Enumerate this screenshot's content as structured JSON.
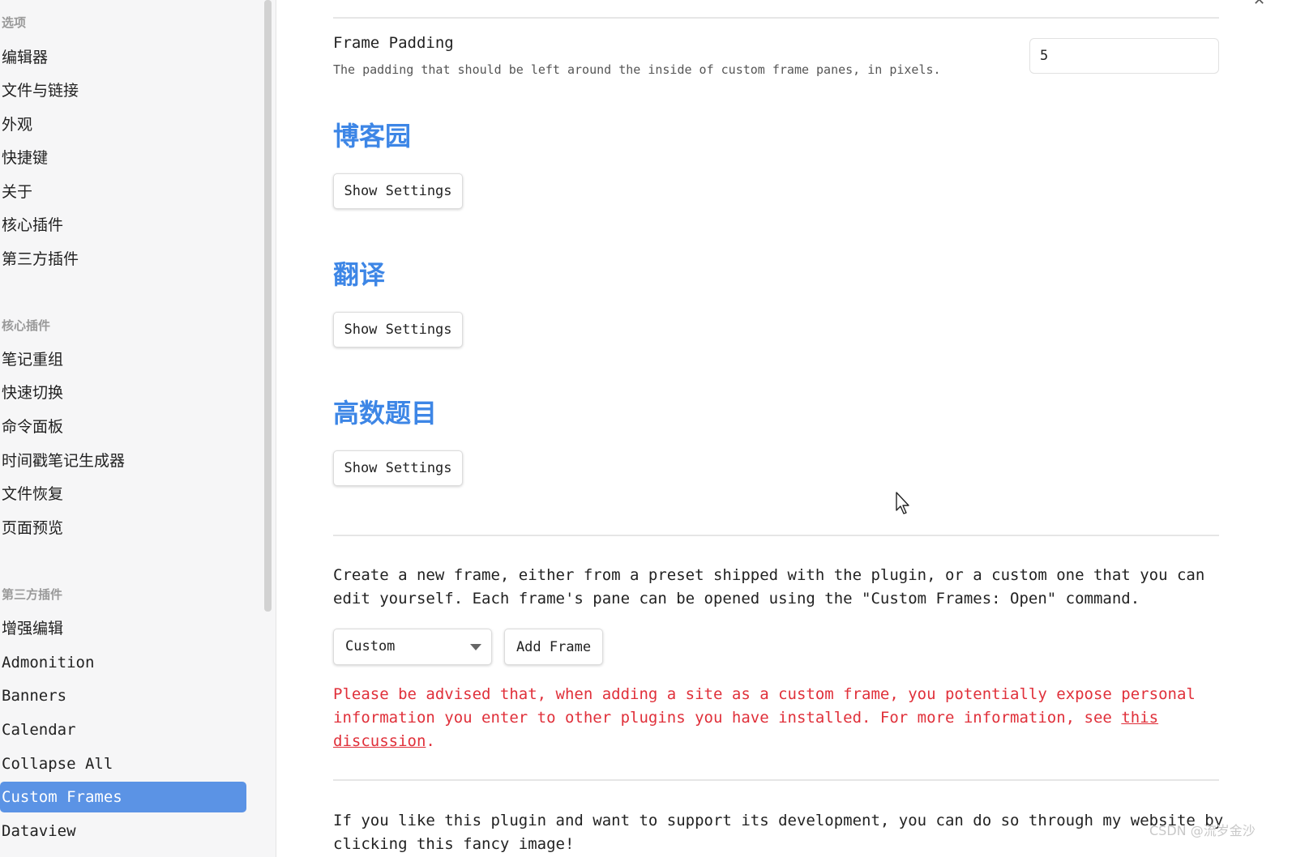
{
  "sidebar": {
    "options_heading": "选项",
    "options_items": [
      "编辑器",
      "文件与链接",
      "外观",
      "快捷键",
      "关于",
      "核心插件",
      "第三方插件"
    ],
    "core_heading": "核心插件",
    "core_items": [
      "笔记重组",
      "快速切换",
      "命令面板",
      "时间戳笔记生成器",
      "文件恢复",
      "页面预览"
    ],
    "community_heading": "第三方插件",
    "community_items": [
      "增强编辑",
      "Admonition",
      "Banners",
      "Calendar",
      "Collapse All",
      "Custom Frames",
      "Dataview"
    ],
    "active_item": "Custom Frames"
  },
  "frame_padding": {
    "name": "Frame Padding",
    "description": "The padding that should be left around the inside of custom frame panes, in pixels.",
    "value": "5"
  },
  "frames": [
    {
      "title": "博客园",
      "button_label": "Show Settings"
    },
    {
      "title": "翻译",
      "button_label": "Show Settings"
    },
    {
      "title": "高数题目",
      "button_label": "Show Settings"
    }
  ],
  "create": {
    "description": "Create a new frame, either from a preset shipped with the plugin, or a custom one that you can edit yourself. Each frame's pane can be opened using the \"Custom Frames: Open\" command.",
    "preset_selected": "Custom",
    "add_button_label": "Add Frame"
  },
  "warning": {
    "text": "Please be advised that, when adding a site as a custom frame, you potentially expose personal information you enter to other plugins you have installed. For more information, see ",
    "link_text": "this discussion",
    "end": "."
  },
  "support": {
    "text": "If you like this plugin and want to support its development, you can do so through my website by clicking this fancy image!"
  },
  "watermark": "CSDN @流岁金沙",
  "colors": {
    "accent": "#3d86e6",
    "active_bg": "#5b93e5",
    "warning": "#e0303a"
  }
}
